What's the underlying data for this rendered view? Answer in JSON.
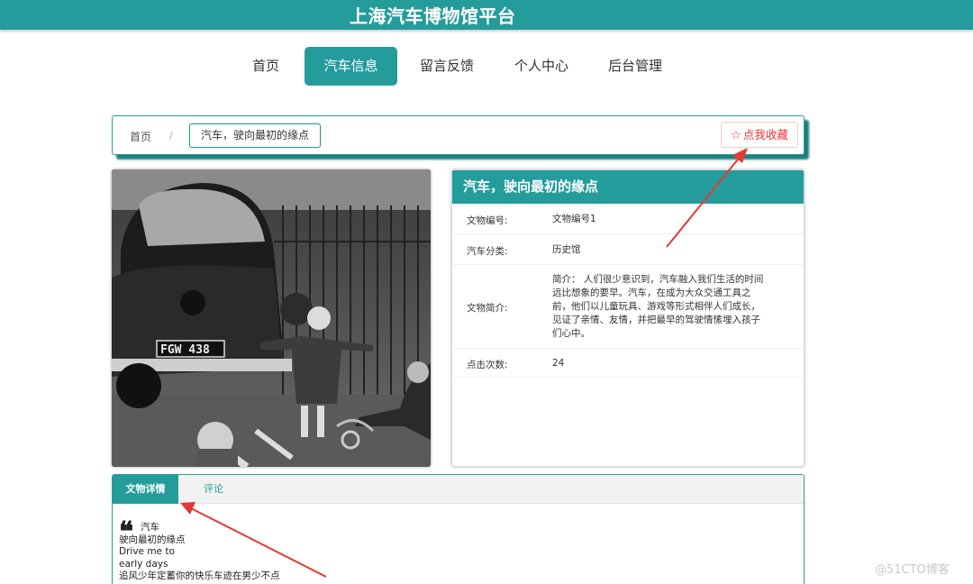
{
  "header": {
    "title": "上海汽车博物馆平台"
  },
  "nav": [
    {
      "label": "首页"
    },
    {
      "label": "汽车信息"
    },
    {
      "label": "留言反馈"
    },
    {
      "label": "个人中心"
    },
    {
      "label": "后台管理"
    }
  ],
  "breadcrumb": {
    "home": "首页",
    "separator": "/",
    "current": "汽车，驶向最初的缘点",
    "favorite_icon": "star-outline-icon",
    "favorite_label": "点我收藏"
  },
  "photo": {
    "plate": "FGW 438"
  },
  "info": {
    "title": "汽车，驶向最初的缘点",
    "rows": [
      {
        "key": "文物编号:",
        "value": "文物编号1"
      },
      {
        "key": "汽车分类:",
        "value": "历史馆"
      },
      {
        "key": "文物简介:",
        "lines": [
          "简介： 人们很少意识到，汽车融入我们生活的时间",
          "远比想象的要早。汽车，在成为大众交通工具之",
          "前，他们以儿童玩具、游戏等形式相伴人们成长，",
          "见证了亲情、友情，并把最早的驾驶情愫埋入孩子",
          "们心中。"
        ]
      },
      {
        "key": "点击次数:",
        "value": "24"
      }
    ]
  },
  "tabs": {
    "active": "文物详情",
    "other": "评论"
  },
  "detail": {
    "quote_icon": "quote-mark-icon",
    "lines": [
      "汽车",
      "驶向最初的缘点",
      "Drive me to",
      "early days",
      "追风少年定蓄你的快乐车迹在男少不点"
    ]
  },
  "watermark": "@51CTO博客",
  "colors": {
    "accent": "#259c9c",
    "favorite": "#e33333",
    "arrow": "#e53935"
  }
}
